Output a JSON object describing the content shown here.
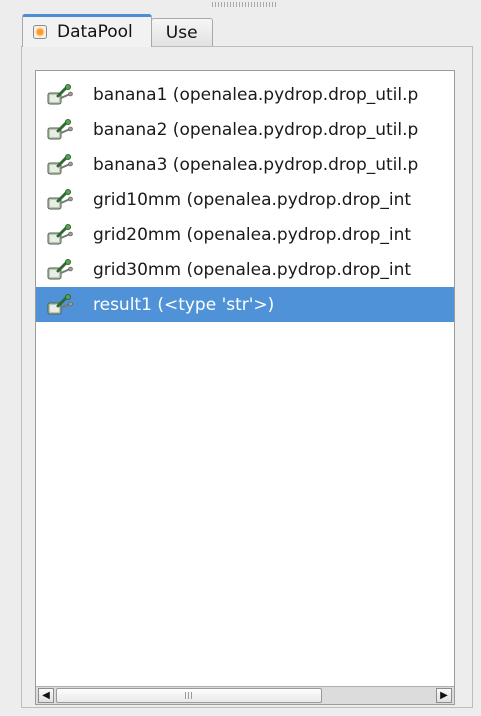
{
  "tabs": [
    {
      "label": "DataPool",
      "active": true
    },
    {
      "label": "Use",
      "active": false
    }
  ],
  "datapool": {
    "items": [
      {
        "label": "banana1 (openalea.pydrop.drop_util.p",
        "selected": false
      },
      {
        "label": "banana2 (openalea.pydrop.drop_util.p",
        "selected": false
      },
      {
        "label": "banana3 (openalea.pydrop.drop_util.p",
        "selected": false
      },
      {
        "label": "grid10mm (openalea.pydrop.drop_int",
        "selected": false
      },
      {
        "label": "grid20mm (openalea.pydrop.drop_int",
        "selected": false
      },
      {
        "label": "grid30mm (openalea.pydrop.drop_int",
        "selected": false
      },
      {
        "label": "result1 (<type 'str'>)",
        "selected": true
      }
    ],
    "item_icon": "data-node-icon"
  },
  "scrollbar": {
    "left_glyph": "◀",
    "right_glyph": "▶"
  },
  "colors": {
    "selection": "#4f92d7",
    "tab_accent": "#4b8ed8",
    "background": "#ededed"
  }
}
